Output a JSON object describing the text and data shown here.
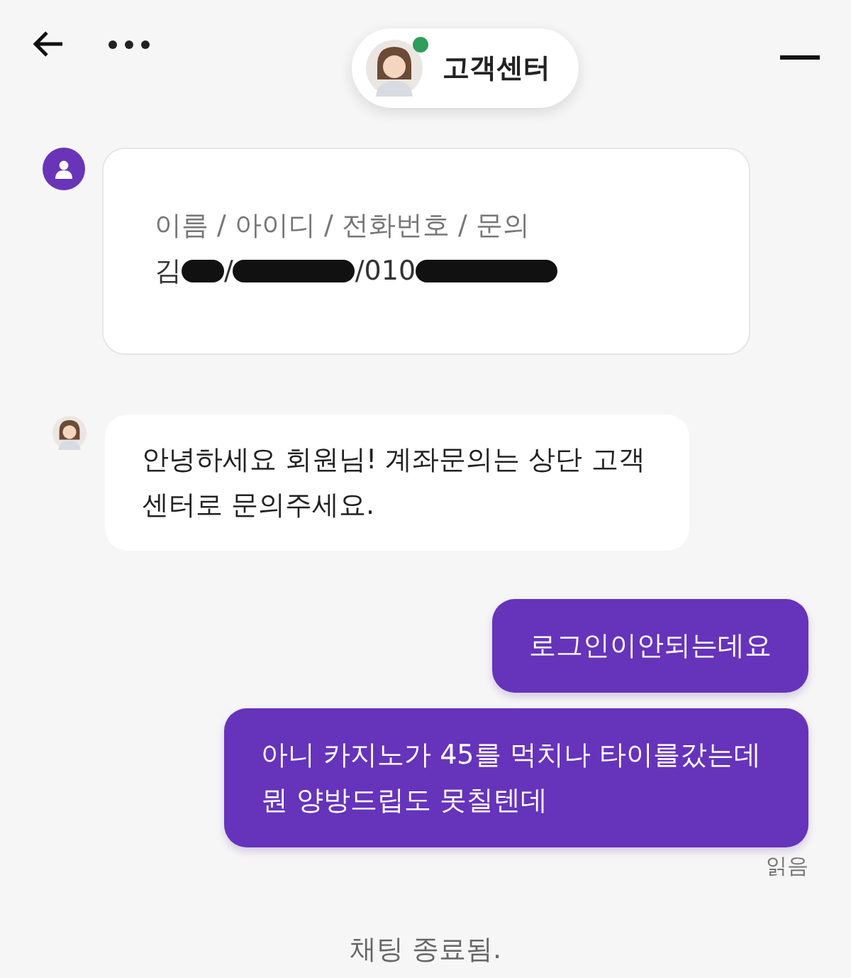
{
  "header": {
    "title": "고객센터",
    "online": true
  },
  "messages": [
    {
      "kind": "form",
      "label": "이름 / 아이디 / 전화번호 / 문의",
      "reply": [
        {
          "kind": "text",
          "text": "김"
        },
        {
          "kind": "redaction"
        },
        {
          "kind": "text",
          "text": "/"
        },
        {
          "kind": "redaction"
        },
        {
          "kind": "text",
          "text": "/010"
        },
        {
          "kind": "redaction"
        }
      ]
    },
    {
      "kind": "agent",
      "text": "안녕하세요 회원님! 계좌문의는 상단 고객센터로 문의주세요."
    },
    {
      "kind": "user",
      "text": "로그인이안되는데요"
    },
    {
      "kind": "user",
      "text": "아니 카지노가 45를 먹치나 타이를갔는데 뭔 양방드립도 못칠텐데"
    }
  ],
  "read_status": "읽음",
  "system_note": "채팅 종료됨."
}
